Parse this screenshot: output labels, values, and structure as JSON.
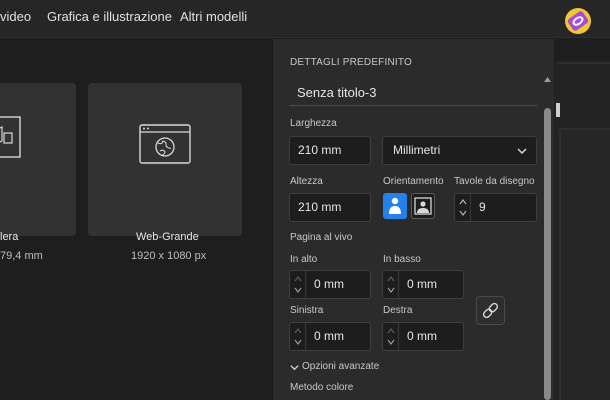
{
  "tabs": [
    "video",
    "Grafica e illustrazione",
    "Altri modelli"
  ],
  "presets": [
    {
      "name": "lera",
      "size": "79,4 mm"
    },
    {
      "name": "Web-Grande",
      "size": "1920 x 1080 px"
    }
  ],
  "panel": {
    "header": "DETTAGLI PREDEFINITO",
    "doc_title": "Senza titolo-3",
    "width_label": "Larghezza",
    "width_value": "210 mm",
    "unit_value": "Millimetri",
    "height_label": "Altezza",
    "height_value": "210 mm",
    "orient_label": "Orientamento",
    "artboards_label": "Tavole da disegno",
    "artboards_value": "9",
    "bleed_label": "Pagina al vivo",
    "top_label": "In alto",
    "top_value": "0 mm",
    "bottom_label": "In basso",
    "bottom_value": "0 mm",
    "left_label": "Sinistra",
    "left_value": "0 mm",
    "right_label": "Destra",
    "right_value": "0 mm",
    "advanced_label": "Opzioni avanzate",
    "color_mode_label": "Metodo colore"
  },
  "colors": {
    "accent": "#2680eb",
    "panel": "#2b2b2b",
    "input": "#1d1d1d"
  },
  "icons": [
    "web-browser-icon",
    "chevron-down-icon",
    "portrait-icon",
    "landscape-icon",
    "link-icon"
  ]
}
